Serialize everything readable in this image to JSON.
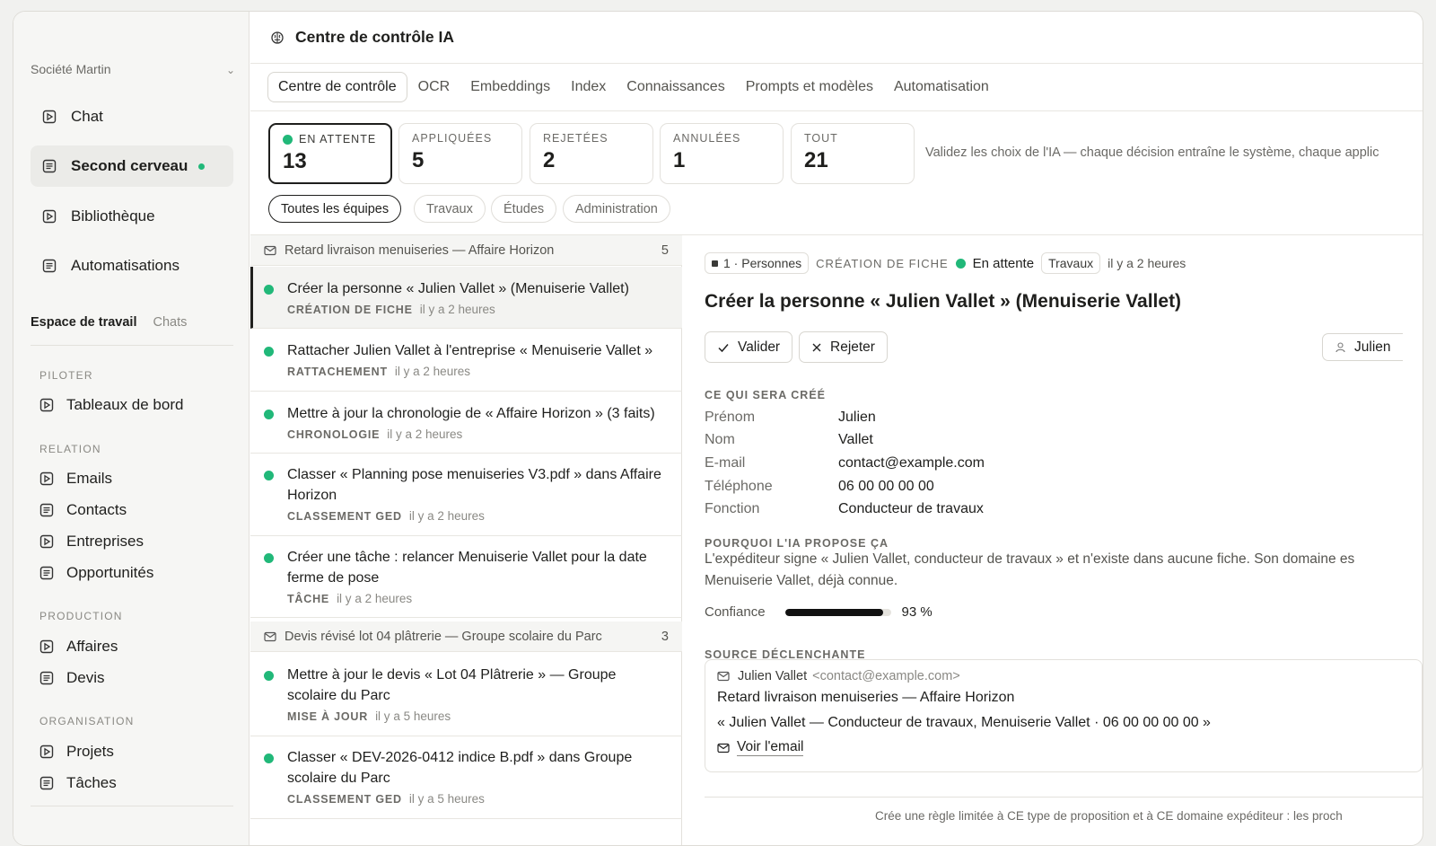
{
  "sidebar": {
    "org": "Société Martin",
    "nav": [
      {
        "label": "Chat",
        "icon": "play-doc-icon"
      },
      {
        "label": "Second cerveau",
        "icon": "doc-icon",
        "active": true
      },
      {
        "label": "Bibliothèque",
        "icon": "play-doc-icon"
      },
      {
        "label": "Automatisations",
        "icon": "doc-icon"
      }
    ],
    "workspace_tab": "Espace de travail",
    "chats_tab": "Chats",
    "sections": {
      "piloter": "PILOTER",
      "relation": "RELATION",
      "production": "PRODUCTION",
      "organisation": "ORGANISATION"
    },
    "items": {
      "dashboards": "Tableaux de bord",
      "emails": "Emails",
      "contacts": "Contacts",
      "companies": "Entreprises",
      "opportunities": "Opportunités",
      "affaires": "Affaires",
      "devis": "Devis",
      "projets": "Projets",
      "taches": "Tâches"
    }
  },
  "header": {
    "title": "Centre de contrôle IA"
  },
  "tabs": [
    "Centre de contrôle",
    "OCR",
    "Embeddings",
    "Index",
    "Connaissances",
    "Prompts et modèles",
    "Automatisation"
  ],
  "stats": [
    {
      "label": "EN ATTENTE",
      "value": "13"
    },
    {
      "label": "APPLIQUÉES",
      "value": "5"
    },
    {
      "label": "REJETÉES",
      "value": "2"
    },
    {
      "label": "ANNULÉES",
      "value": "1"
    },
    {
      "label": "TOUT",
      "value": "21"
    }
  ],
  "hint": "Validez les choix de l'IA — chaque décision entraîne le système, chaque applic",
  "filters": [
    "Toutes les équipes",
    "Travaux",
    "Études",
    "Administration"
  ],
  "groups": [
    {
      "title": "Retard livraison menuiseries — Affaire Horizon",
      "count": "5"
    },
    {
      "title": "Devis révisé lot 04 plâtrerie — Groupe scolaire du Parc",
      "count": "3"
    }
  ],
  "items": [
    {
      "title": "Créer la personne « Julien Vallet » (Menuiserie Vallet)",
      "kind": "CRÉATION DE FICHE",
      "time": "il y a 2 heures"
    },
    {
      "title": "Rattacher Julien Vallet à l'entreprise « Menuiserie Vallet »",
      "kind": "RATTACHEMENT",
      "time": "il y a 2 heures"
    },
    {
      "title": "Mettre à jour la chronologie de « Affaire Horizon » (3 faits)",
      "kind": "CHRONOLOGIE",
      "time": "il y a 2 heures"
    },
    {
      "title": "Classer « Planning pose menuiseries V3.pdf » dans Affaire Horizon",
      "kind": "CLASSEMENT GED",
      "time": "il y a 2 heures"
    },
    {
      "title": "Créer une tâche : relancer Menuiserie Vallet pour la date ferme de pose",
      "kind": "TÂCHE",
      "time": "il y a 2 heures"
    },
    {
      "title": "Mettre à jour le devis « Lot 04 Plâtrerie » — Groupe scolaire du Parc",
      "kind": "MISE À JOUR",
      "time": "il y a 5 heures"
    },
    {
      "title": "Classer « DEV-2026-0412 indice B.pdf » dans Groupe scolaire du Parc",
      "kind": "CLASSEMENT GED",
      "time": "il y a 5 heures"
    }
  ],
  "detail": {
    "pill": "1 · Personnes",
    "kind": "CRÉATION DE FICHE",
    "status": "En attente",
    "team": "Travaux",
    "time": "il y a 2 heures",
    "title": "Créer la personne « Julien Vallet » (Menuiserie Vallet)",
    "validate": "Valider",
    "reject": "Rejeter",
    "assignee": "Julien",
    "what_label": "CE QUI SERA CRÉÉ",
    "fields": [
      {
        "k": "Prénom",
        "v": "Julien"
      },
      {
        "k": "Nom",
        "v": "Vallet"
      },
      {
        "k": "E-mail",
        "v": "contact@example.com"
      },
      {
        "k": "Téléphone",
        "v": "06 00 00 00 00"
      },
      {
        "k": "Fonction",
        "v": "Conducteur de travaux"
      }
    ],
    "why_label": "POURQUOI L'IA PROPOSE ÇA",
    "why": "L'expéditeur signe « Julien Vallet, conducteur de travaux » et n'existe dans aucune fiche. Son domaine es Menuiserie Vallet, déjà connue.",
    "confidence_label": "Confiance",
    "confidence": 0.93,
    "confidence_text": "93 %",
    "source_label": "SOURCE DÉCLENCHANTE",
    "source": {
      "from_name": "Julien Vallet",
      "from_email": "<contact@example.com>",
      "subject": "Retard livraison menuiseries — Affaire Horizon",
      "quote": "« Julien Vallet — Conducteur de travaux, Menuiserie Vallet · 06 00 00 00 00 »",
      "link": "Voir l'email"
    },
    "footer": "Crée une règle limitée à CE type de proposition et à CE domaine expéditeur : les proch"
  }
}
